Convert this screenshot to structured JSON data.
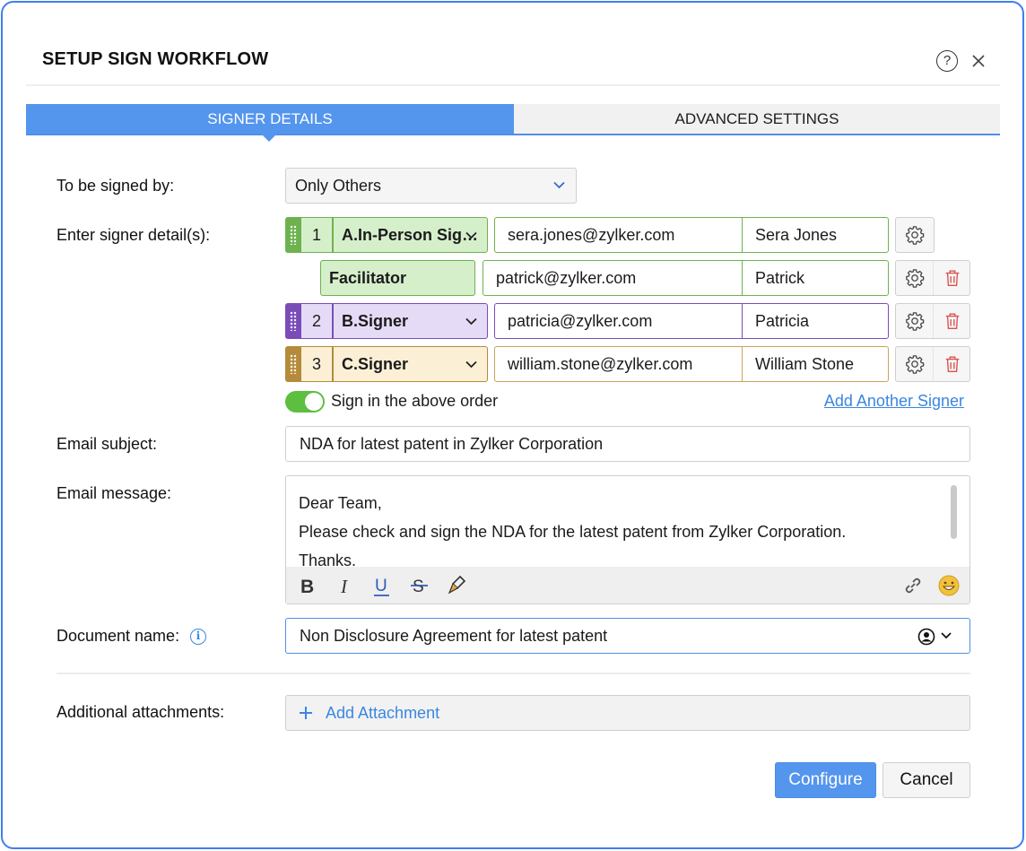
{
  "dialog": {
    "title": "SETUP SIGN WORKFLOW"
  },
  "tabs": [
    {
      "label": "SIGNER DETAILS",
      "active": true
    },
    {
      "label": "ADVANCED SETTINGS",
      "active": false
    }
  ],
  "signed_by": {
    "label": "To be signed by:",
    "value": "Only Others"
  },
  "signers_label": "Enter signer detail(s):",
  "signers": [
    {
      "order": "1",
      "role": "A.In-Person Sig…",
      "email": "sera.jones@zylker.com",
      "name": "Sera Jones",
      "color": "#6db24f",
      "tint": "#d6efcb"
    },
    {
      "role": "Facilitator",
      "email": "patrick@zylker.com",
      "name": "Patrick",
      "color": "#6db24f",
      "tint": "#d6efcb"
    },
    {
      "order": "2",
      "role": "B.Signer",
      "email": "patricia@zylker.com",
      "name": "Patricia",
      "color": "#7a4cb8",
      "tint": "#e6dbf6"
    },
    {
      "order": "3",
      "role": "C.Signer",
      "email": "william.stone@zylker.com",
      "name": "William Stone",
      "color": "#b58b3b",
      "tint": "#fbf0d6"
    }
  ],
  "sign_order": {
    "label": "Sign in the above order",
    "enabled": true
  },
  "add_signer_label": "Add Another Signer",
  "email_subject": {
    "label": "Email subject:",
    "value": "NDA for latest patent in Zylker Corporation"
  },
  "email_message": {
    "label": "Email message:",
    "lines": [
      "Dear Team,",
      "Please check and sign the NDA for the latest patent from Zylker Corporation.",
      "Thanks."
    ],
    "toolbar": [
      "bold-icon",
      "italic-icon",
      "underline-icon",
      "strikethrough-icon",
      "format-painter-icon",
      "link-icon",
      "emoji-icon"
    ]
  },
  "document_name": {
    "label": "Document name:",
    "value": "Non Disclosure Agreement for latest patent"
  },
  "attachments": {
    "label": "Additional attachments:",
    "button": "Add Attachment"
  },
  "footer": {
    "configure": "Configure",
    "cancel": "Cancel"
  },
  "colors": {
    "accent": "#5495ee",
    "link": "#3b86e0",
    "toggle_on": "#5cbf3f",
    "danger": "#d9534f"
  }
}
